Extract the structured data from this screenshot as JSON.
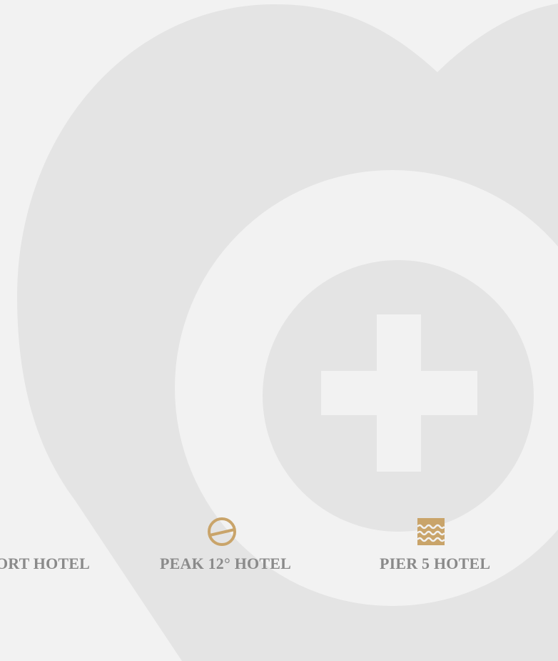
{
  "colors": {
    "background": "#f2f2f2",
    "shape": "#e4e4e4",
    "accent_gold": "#c9a46a",
    "label_gray": "#8a8a8a"
  },
  "background_art": {
    "icon": "heart-with-medical-cross-icon"
  },
  "hotels": [
    {
      "label": "ORT HOTEL",
      "icon": null
    },
    {
      "label": "PEAK 12° HOTEL",
      "icon": "circle-slash-logo-icon"
    },
    {
      "label": "PIER 5 HOTEL",
      "icon": "waves-square-logo-icon"
    }
  ]
}
